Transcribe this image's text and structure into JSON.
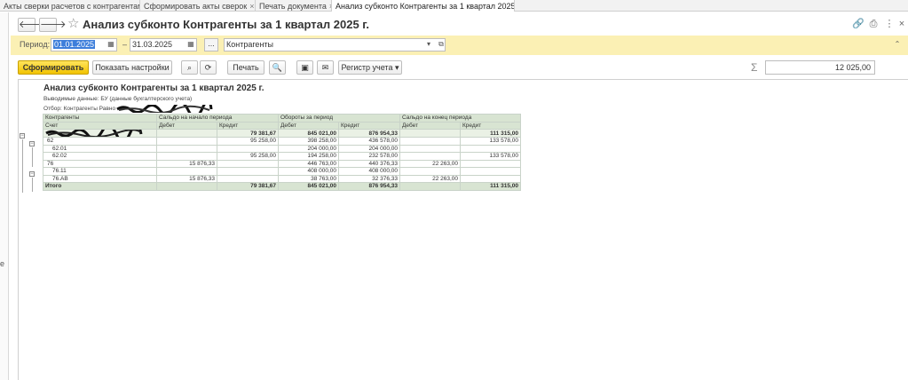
{
  "tabs": [
    {
      "label": "Акты сверки расчетов с контрагентами",
      "active": false
    },
    {
      "label": "Сформировать акты сверок",
      "active": false
    },
    {
      "label": "Печать документа",
      "active": false
    },
    {
      "label": "Анализ субконто Контрагенты за 1 квартал 2025 г.",
      "active": true
    }
  ],
  "left_strip_text": "е",
  "page": {
    "title": "Анализ субконто Контрагенты за 1 квартал 2025 г.",
    "back_icon": "arrow-left-icon",
    "forward_icon": "arrow-right-icon",
    "favorite_icon": "star-icon"
  },
  "filters": {
    "period_label": "Период:",
    "date_from": "01.01.2025",
    "date_to": "31.03.2025",
    "dash": "–",
    "dots": "...",
    "subconto": "Контрагенты"
  },
  "toolbar": {
    "generate": "Сформировать",
    "settings": "Показать настройки",
    "print": "Печать",
    "register": "Регистр учета",
    "sigma": "Σ",
    "sum_value": "12 025,00"
  },
  "report": {
    "title": "Анализ субконто Контрагенты за 1 квартал 2025 г.",
    "output_data": "Выводимые данные: БУ (данные бухгалтерского учета)",
    "filter": "Отбор: Контрагенты Равно",
    "headers": {
      "counterparties": "Контрагенты",
      "account": "Счет",
      "opening": "Сальдо на начало периода",
      "turnover": "Обороты за период",
      "closing": "Сальдо на конец периода",
      "debit": "Дебет",
      "credit": "Кредит"
    },
    "rows": [
      {
        "label": "",
        "v": [
          "",
          "79 381,67",
          "845 021,00",
          "876 954,33",
          "",
          "111 315,00"
        ],
        "kind": "grp"
      },
      {
        "label": "62",
        "v": [
          "",
          "95 258,00",
          "398 258,00",
          "436 578,00",
          "",
          "133 578,00"
        ],
        "kind": "sub"
      },
      {
        "label": "62.01",
        "v": [
          "",
          "",
          "204 000,00",
          "204 000,00",
          "",
          ""
        ],
        "kind": "leaf"
      },
      {
        "label": "62.02",
        "v": [
          "",
          "95 258,00",
          "194 258,00",
          "232 578,00",
          "",
          "133 578,00"
        ],
        "kind": "leaf"
      },
      {
        "label": "76",
        "v": [
          "15 876,33",
          "",
          "446 763,00",
          "440 376,33",
          "22 263,00",
          ""
        ],
        "kind": "sub"
      },
      {
        "label": "76.11",
        "v": [
          "",
          "",
          "408 000,00",
          "408 000,00",
          "",
          ""
        ],
        "kind": "leaf"
      },
      {
        "label": "76.АВ",
        "v": [
          "15 876,33",
          "",
          "38 763,00",
          "32 376,33",
          "22 263,00",
          ""
        ],
        "kind": "leaf"
      }
    ],
    "total": {
      "label": "Итого",
      "v": [
        "",
        "79 381,67",
        "845 021,00",
        "876 954,33",
        "",
        "111 315,00"
      ]
    }
  }
}
